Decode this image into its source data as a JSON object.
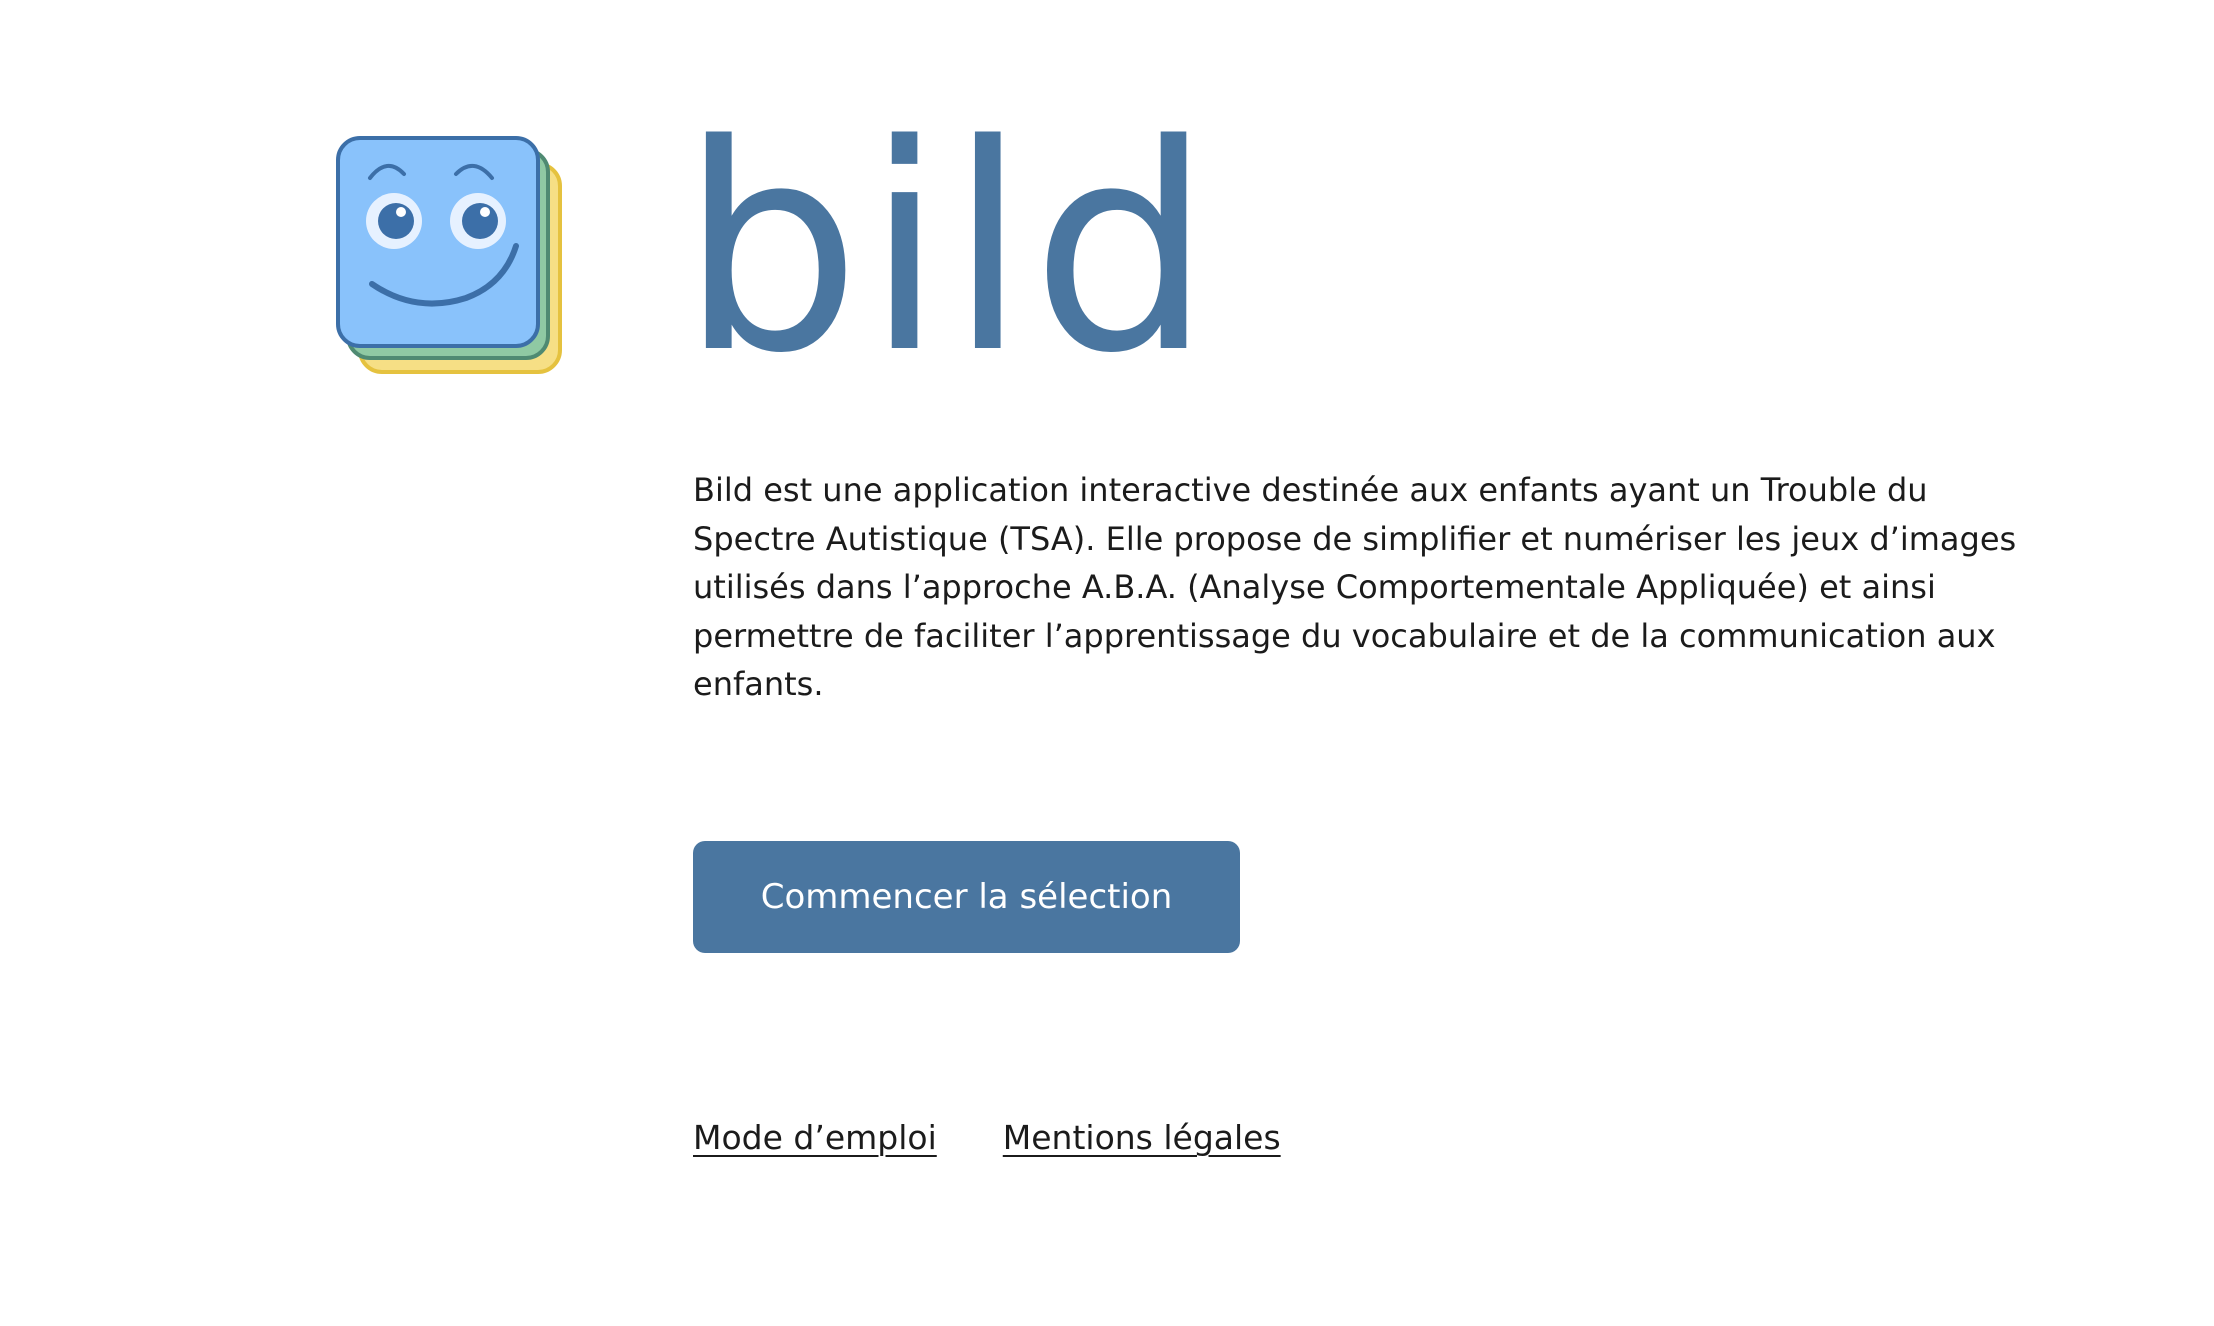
{
  "brand": {
    "name": "bild",
    "color": "#4a76a0",
    "icon": "smiling-cards-logo-icon"
  },
  "intro": {
    "text": "Bild est une application interactive destinée aux enfants ayant un Trouble du Spectre Autistique (TSA). Elle propose de simplifier et numériser les jeux d’images utilisés dans l’approche A.B.A. (Analyse Comportementale Appliquée) et ainsi permettre de faciliter l’apprentissage du vocabulaire et de la communication aux enfants."
  },
  "actions": {
    "start_label": "Commencer la sélection"
  },
  "footer": {
    "links": [
      {
        "label": "Mode d’emploi"
      },
      {
        "label": "Mentions légales"
      }
    ]
  },
  "colors": {
    "accent": "#4a76a0",
    "card_blue": "#89c2fb",
    "card_green": "#8fc9a3",
    "card_yellow": "#f6df85",
    "text": "#1b1b1b",
    "background": "#ffffff"
  }
}
